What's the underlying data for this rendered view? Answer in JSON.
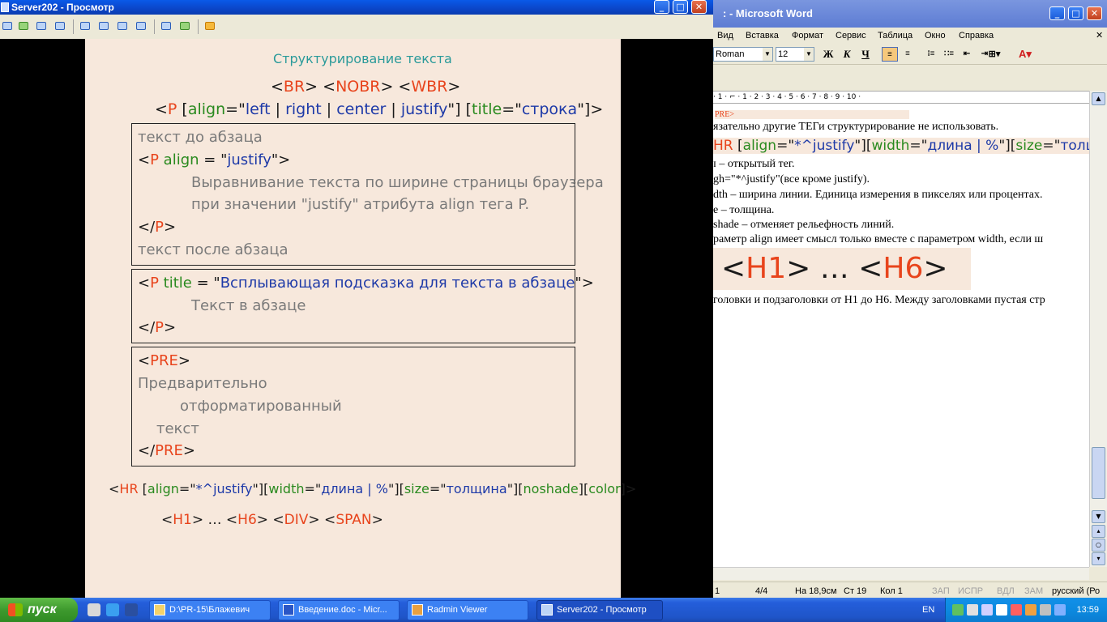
{
  "left_window": {
    "title": "Server202 - Просмотр",
    "controls": {
      "minimize": "_",
      "maximize": "□",
      "close": "✕"
    }
  },
  "slide": {
    "heading": "Структурирование текста",
    "line_br": {
      "a": "<",
      "b": "BR",
      "c": "> <",
      "d": "NOBR",
      "e": "> <",
      "f": "WBR",
      "g": ">"
    },
    "line_p": {
      "open": "<",
      "tag": "P",
      "sp": " [",
      "attr1": "align",
      "eq1": "=\"",
      "v1": "left",
      "bar1": " | ",
      "v2": "right",
      "bar2": " | ",
      "v3": "center",
      "bar3": " | ",
      "v4": "justify",
      "close1": "\"] [",
      "attr2": "title",
      "eq2": "=\"",
      "v5": "строка",
      "close2": "\"]>"
    },
    "box1": {
      "line1": "текст до абзаца",
      "line2": {
        "a": "<",
        "b": "P",
        "c": " align",
        "d": " = \"",
        "e": "justify",
        "f": "\">"
      },
      "line3": "Выравнивание текста по ширине страницы браузера",
      "line4": "при значении \"justify\" атрибута align тега P.",
      "line5": {
        "a": "</",
        "b": "P",
        "c": ">"
      },
      "line6": "текст после абзаца"
    },
    "box2": {
      "line1": {
        "a": "<",
        "b": "P",
        "c": " title",
        "d": " = \"",
        "e": "Всплывающая подсказка для текста в абзаце",
        "f": "\">"
      },
      "line2": "Текст в абзаце",
      "line3": {
        "a": "</",
        "b": "P",
        "c": ">"
      }
    },
    "box3": {
      "line1": {
        "a": "<",
        "b": "PRE",
        "c": ">"
      },
      "line2": "Предварительно",
      "line3": "отформатированный",
      "line4": "текст",
      "line5": {
        "a": "</",
        "b": "PRE",
        "c": ">"
      }
    },
    "line_hr": {
      "a": "<",
      "b": "HR",
      "c": " [",
      "d": "align",
      "e": "=\"",
      "f": "*^justify",
      "g": "\"][",
      "h": "width",
      "i": "=\"",
      "j": "длина | %",
      "k": "\"][",
      "l": "size",
      "m": "=\"",
      "n": "толщина",
      "o": "\"][",
      "p": "noshade",
      "q": "][",
      "r": "color",
      "s": "]>"
    },
    "line_h": {
      "a": "<",
      "b": "H1",
      "c": "> … <",
      "d": "H6",
      "e": "> <",
      "f": "DIV",
      "g": "> <",
      "h": "SPAN",
      "i": ">"
    }
  },
  "word": {
    "title": ": - Microsoft Word",
    "menu": [
      "Вид",
      "Вставка",
      "Формат",
      "Сервис",
      "Таблица",
      "Окно",
      "Справка"
    ],
    "font_name": "Roman",
    "font_size": "12",
    "format_buttons": {
      "bold": "Ж",
      "italic": "К",
      "underline": "Ч"
    },
    "ruler": "· 1 · ⌐ · 1 · 2 · 3 · 4 · 5 · 6 · 7 · 8 · 9 · 10 · ",
    "doc_lines": {
      "pre": "PRE>",
      "l1": "язательно другие ТЕГи структурирование не использовать.",
      "hr": {
        "a": "HR",
        "b": " [",
        "c": "align",
        "d": "=\"",
        "e": "*^justify",
        "f": "\"][",
        "g": "width",
        "h": "=\"",
        "i": "длина | %",
        "j": "\"][",
        "k": "size",
        "l": "=\"",
        "m": "толщи"
      },
      "l2": "ɪ – открытый тег.",
      "l3": "gh=\"*^justify\"(все кроме justify).",
      "l4": "dth – ширина линии. Единица измерения в пикселях или процентах.",
      "l5": "e – толщина.",
      "l6": "shade – отменяет рельефность линий.",
      "l7": "раметр align имеет смысл только вместе с параметром width, если ш",
      "h": {
        "a": "<",
        "b": "H1",
        "c": "> … <",
        "d": "H6",
        "e": ">"
      },
      "l8": "головки и подзаголовки от H1 до H6. Между заголовками пустая стр"
    },
    "status": {
      "page": "1",
      "pages": "4/4",
      "at": "На 18,9см",
      "line": "Ст 19",
      "col": "Кол 1",
      "rec": "ЗАП",
      "trk": "ИСПР",
      "ext": "ВДЛ",
      "ovr": "ЗАМ",
      "lang": "русский (Ро"
    }
  },
  "taskbar": {
    "start": "пуск",
    "tasks": [
      {
        "label": "D:\\PR-15\\Блажевич"
      },
      {
        "label": "Введение.doc - Micr..."
      },
      {
        "label": "Radmin Viewer"
      },
      {
        "label": "Server202 - Просмотр"
      }
    ],
    "lang": "EN",
    "clock": "13:59"
  }
}
